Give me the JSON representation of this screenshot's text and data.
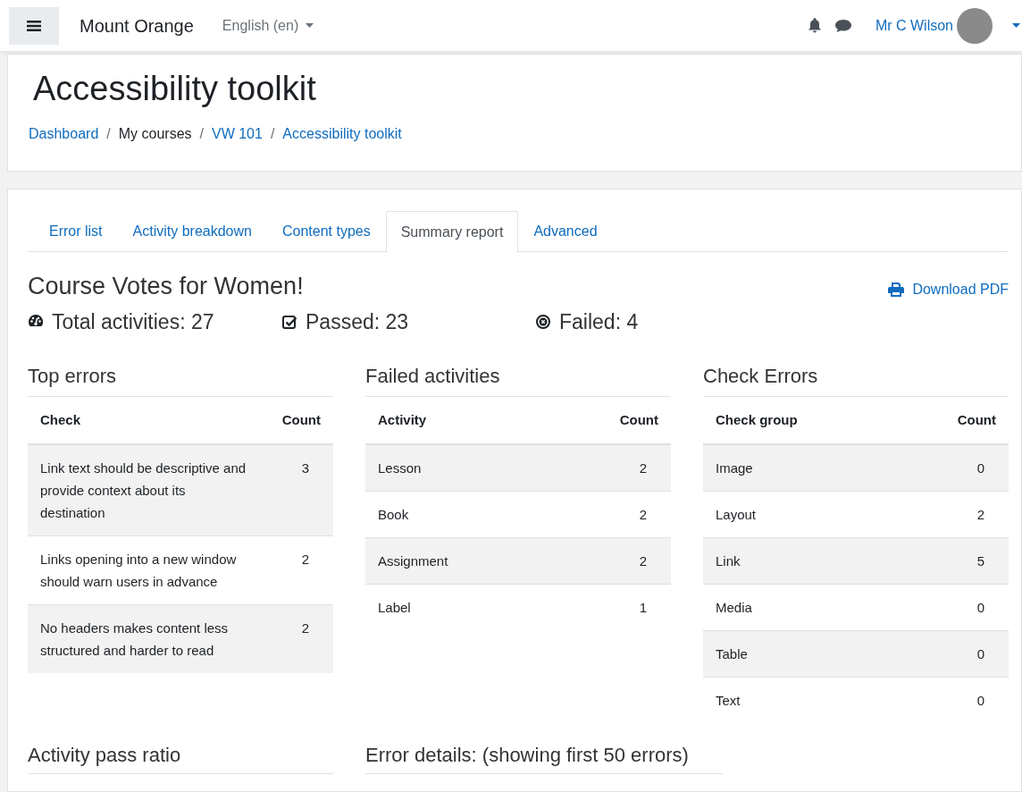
{
  "navbar": {
    "site_name": "Mount Orange",
    "language": "English (en)",
    "user_name": "Mr C Wilson"
  },
  "header": {
    "title": "Accessibility toolkit",
    "breadcrumbs": [
      {
        "label": "Dashboard",
        "link": true
      },
      {
        "separator": "/",
        "label": "My courses",
        "link": false
      },
      {
        "separator": "/",
        "label": "VW 101",
        "link": true
      },
      {
        "separator": "/",
        "label": "Accessibility toolkit",
        "link": true
      }
    ]
  },
  "tabs": [
    {
      "label": "Error list",
      "selected": false
    },
    {
      "label": "Activity breakdown",
      "selected": false
    },
    {
      "label": "Content types",
      "selected": false
    },
    {
      "label": "Summary report",
      "selected": true
    },
    {
      "label": "Advanced",
      "selected": false
    }
  ],
  "report": {
    "title": "Course Votes for Women!",
    "download_label": "Download PDF",
    "stats": [
      {
        "kind": "total",
        "label": "Total activities: 27"
      },
      {
        "kind": "passed",
        "label": "Passed: 23"
      },
      {
        "kind": "failed",
        "label": "Failed: 4"
      }
    ],
    "tables": [
      {
        "title": "Top errors",
        "columns": [
          "Check",
          "Count"
        ],
        "rows": [
          [
            "Link text should be descriptive and provide context about its destination",
            "3"
          ],
          [
            "Links opening into a new window should warn users in advance",
            "2"
          ],
          [
            "No headers makes content less structured and harder to read",
            "2"
          ]
        ]
      },
      {
        "title": "Failed activities",
        "columns": [
          "Activity",
          "Count"
        ],
        "rows": [
          [
            "Lesson",
            "2"
          ],
          [
            "Book",
            "2"
          ],
          [
            "Assignment",
            "2"
          ],
          [
            "Label",
            "1"
          ]
        ]
      },
      {
        "title": "Check Errors",
        "columns": [
          "Check group",
          "Count"
        ],
        "rows": [
          [
            "Image",
            "0"
          ],
          [
            "Layout",
            "2"
          ],
          [
            "Link",
            "5"
          ],
          [
            "Media",
            "0"
          ],
          [
            "Table",
            "0"
          ],
          [
            "Text",
            "0"
          ]
        ]
      }
    ],
    "bottom_headings": [
      "Activity pass ratio",
      "Error details: (showing first 50 errors)"
    ]
  }
}
